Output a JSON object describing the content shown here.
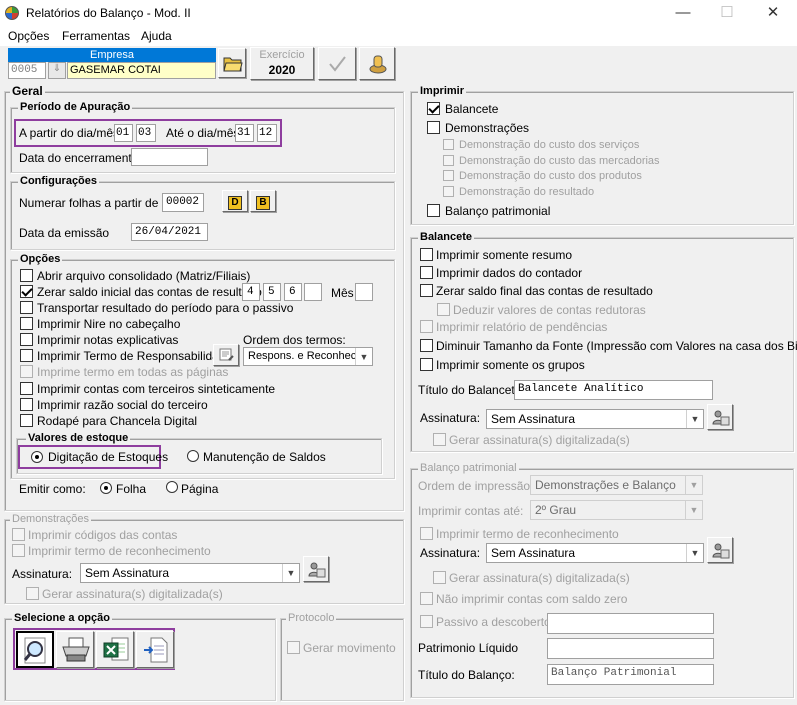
{
  "window": {
    "title": "Relatórios do Balanço - Mod. II",
    "minimize": "—",
    "maximize": "☐",
    "close": "✕"
  },
  "menu": [
    "Opções",
    "Ferramentas",
    "Ajuda"
  ],
  "empresa": {
    "header": "Empresa",
    "code": "0005",
    "name": "GASEMAR COTAI"
  },
  "exercicio": {
    "label": "Exercício",
    "value": "2020"
  },
  "geral": {
    "title": "Geral"
  },
  "periodo": {
    "title": "Período de Apuração",
    "a_partir_label": "A partir do dia/mês",
    "start_day": "01",
    "start_month": "03",
    "ate_label": "Até o dia/mês",
    "end_day": "31",
    "end_month": "12",
    "encerramento_label": "Data do encerramento",
    "encerramento_value": ""
  },
  "config": {
    "title": "Configurações",
    "numerar_label": "Numerar folhas a partir de",
    "numerar_value": "00002",
    "btn_d": "D",
    "btn_b": "B",
    "emissao_label": "Data da emissão",
    "emissao_value": "26/04/2021"
  },
  "opcoes": {
    "title": "Opções",
    "abrir": "Abrir arquivo consolidado (Matriz/Filiais)",
    "zerar": "Zerar saldo inicial das contas de resultado",
    "zerar_v1": "4",
    "zerar_v2": "5",
    "zerar_v3": "6",
    "zerar_v4": "",
    "mes_label": "Mês",
    "mes_value": "",
    "transportar": "Transportar resultado do período para o passivo",
    "nire": "Imprimir Nire no cabeçalho",
    "notas": "Imprimir notas explicativas",
    "termo": "Imprimir Termo de Responsabilidade",
    "ordem_label": "Ordem dos termos:",
    "ordem_value": "Respons. e Reconhec.",
    "imprime_termo": "Imprime termo em todas as páginas",
    "contas_terceiros": "Imprimir contas com terceiros sinteticamente",
    "razao_social": "Imprimir razão social do terceiro",
    "rodape": "Rodapé para Chancela Digital"
  },
  "estoque": {
    "title": "Valores de estoque",
    "digitacao": "Digitação de Estoques",
    "manutencao": "Manutenção de Saldos"
  },
  "emitir": {
    "label": "Emitir como:",
    "folha": "Folha",
    "pagina": "Página"
  },
  "demonstracoes": {
    "title": "Demonstrações",
    "codigos": "Imprimir códigos das contas",
    "termo": "Imprimir termo de reconhecimento",
    "assinatura_label": "Assinatura:",
    "assinatura_value": "Sem Assinatura",
    "gerar": "Gerar assinatura(s) digitalizada(s)"
  },
  "selecione": {
    "title": "Selecione a opção"
  },
  "protocolo": {
    "title": "Protocolo",
    "gerar": "Gerar movimento"
  },
  "imprimir": {
    "title": "Imprimir",
    "balancete": "Balancete",
    "demonstracoes": "Demonstrações",
    "custo_servicos": "Demonstração do custo dos serviços",
    "custo_mercadorias": "Demonstração do custo das mercadorias",
    "custo_produtos": "Demonstração do custo dos produtos",
    "resultado": "Demonstração do resultado",
    "balanco": "Balanço patrimonial"
  },
  "balancete": {
    "title": "Balancete",
    "resumo": "Imprimir somente resumo",
    "contador": "Imprimir dados do contador",
    "zerar": "Zerar saldo final das contas de resultado",
    "deduzir": "Deduzir valores de contas redutoras",
    "pendencias": "Imprimir relatório de pendências",
    "diminuir": "Diminuir Tamanho da Fonte (Impressão com Valores na casa dos Bilhões)",
    "grupos": "Imprimir somente os grupos",
    "titulo_label": "Título do Balancete:",
    "titulo_value": "Balancete Analítico",
    "assinatura_label": "Assinatura:",
    "assinatura_value": "Sem Assinatura",
    "gerar": "Gerar assinatura(s) digitalizada(s)"
  },
  "balanco": {
    "title": "Balanço patrimonial",
    "ordem_label": "Ordem de impressão:",
    "ordem_value": "Demonstrações e Balanço",
    "contas_label": "Imprimir contas até:",
    "contas_value": "2º Grau",
    "termo": "Imprimir termo de reconhecimento",
    "assinatura_label": "Assinatura:",
    "assinatura_value": "Sem Assinatura",
    "gerar": "Gerar assinatura(s) digitalizada(s)",
    "nao_zero": "Não imprimir contas com saldo zero",
    "passivo": "Passivo a descoberto",
    "passivo_value": "",
    "patrimonio_label": "Patrimonio Líquido",
    "patrimonio_value": "",
    "titulo_label": "Título do Balanço:",
    "titulo_value": "Balanço Patrimonial"
  },
  "colors": {
    "highlight": "#8e3d9e",
    "empresa_header": "#0078d7",
    "empresa_name_bg": "#ffffc8"
  }
}
